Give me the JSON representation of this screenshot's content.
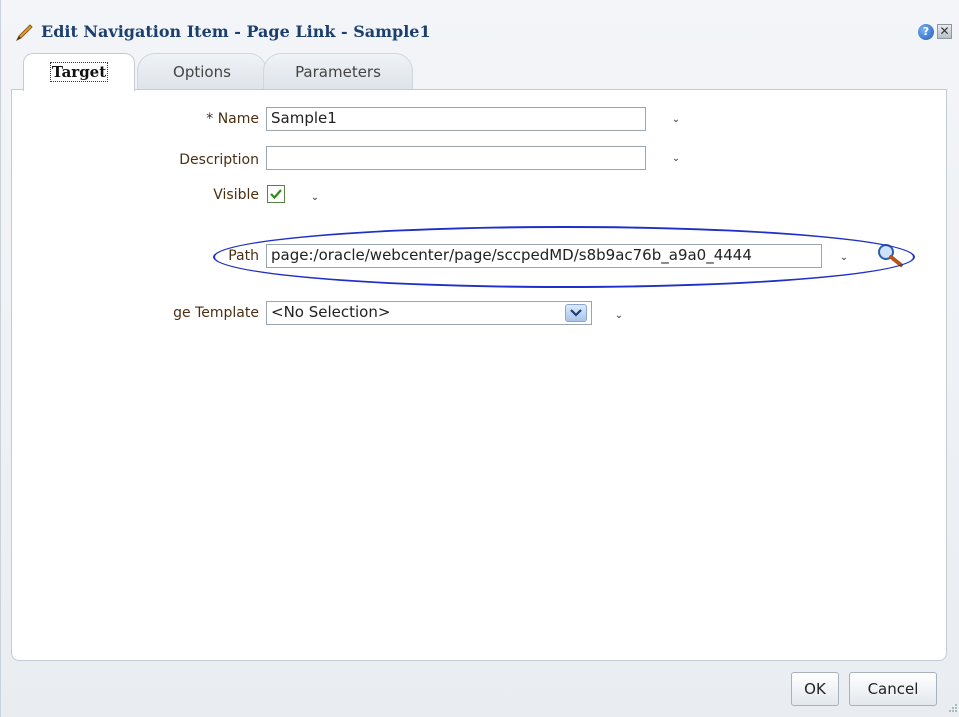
{
  "dialog": {
    "title": "Edit Navigation Item - Page Link - Sample1",
    "help_glyph": "?",
    "close_glyph": "✕"
  },
  "tabs": [
    {
      "label": "Target",
      "active": true
    },
    {
      "label": "Options",
      "active": false
    },
    {
      "label": "Parameters",
      "active": false
    }
  ],
  "form": {
    "name": {
      "required_marker": "*",
      "label": "Name",
      "value": "Sample1"
    },
    "description": {
      "label": "Description",
      "value": ""
    },
    "visible": {
      "label": "Visible",
      "checked": true,
      "check_glyph": "✔"
    },
    "path": {
      "label": "Path",
      "value": "page:/oracle/webcenter/page/sccpedMD/s8b9ac76b_a9a0_4444"
    },
    "page_template": {
      "label": "ge Template",
      "value": "<No Selection>"
    }
  },
  "chevron_glyph": "⌄",
  "footer": {
    "ok_label": "OK",
    "cancel_label": "Cancel"
  },
  "icons": [
    "pencil-icon",
    "help-icon",
    "close-icon",
    "search-icon",
    "chevron-down-icon",
    "checkmark-icon"
  ],
  "colors": {
    "title": "#1b3f6e",
    "label": "#4a2f12",
    "highlight_ellipse": "#1f2fc7",
    "check": "#2f8a1c"
  }
}
